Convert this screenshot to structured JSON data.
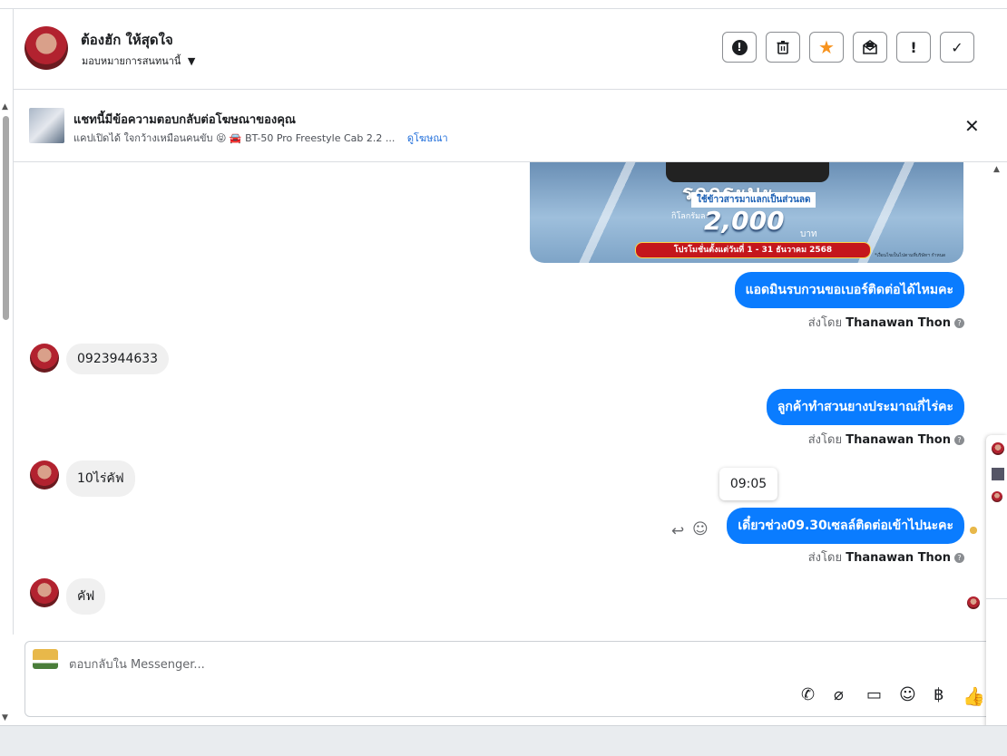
{
  "header": {
    "contact_name": "ต้องฮัก ให้สุดใจ",
    "assign_label": "มอบหมายการสนทนานี้",
    "buttons": [
      {
        "name": "report-button",
        "icon": "!"
      },
      {
        "name": "delete-button",
        "icon": "🗑"
      },
      {
        "name": "star-button",
        "icon": "★"
      },
      {
        "name": "mark-unread-button",
        "icon": "✉"
      },
      {
        "name": "spam-button",
        "icon": "!"
      },
      {
        "name": "done-button",
        "icon": "✓"
      }
    ]
  },
  "ad": {
    "title": "แชทนี้มีข้อความตอบกลับต่อโฆษณาของคุณ",
    "subtitle": "แคปเปิดได้ ใจกว้างเหมือนคนขับ 😝 🚘 BT-50 Pro Freestyle Cab 2.2 ...",
    "link": "ดูโฆษณา"
  },
  "ad_image": {
    "headline": "รถกระบะ",
    "tag": "ใช้ข้าวสารมาแลกเป็นส่วนลด",
    "per_kg": "กิโลกรัมละ",
    "amount": "2,000",
    "unit": "บาท",
    "promo": "โปรโมชั่นตั้งแต่วันที่ 1 - 31 ธันวาคม 2568",
    "note": "*เงื่อนไขเป็นไปตามที่บริษัทฯ กำหนด"
  },
  "messages": {
    "m1": "แอดมินรบกวนขอเบอร์ติดต่อได้ไหมคะ",
    "m2": "0923944633",
    "m3": "ลูกค้าทำสวนยางประมาณกี่ไร่คะ",
    "m4": "10ไร่คัฟ",
    "m5": "เดี๋ยวช่วง09.30เซลล์ติดต่อเข้าไปนะคะ",
    "m6": "คัฟ"
  },
  "sent_by_prefix": "ส่งโดย",
  "sent_by_name": "Thanawan Thon",
  "tooltip_time": "09:05",
  "composer": {
    "placeholder": "ตอบกลับใน Messenger..."
  },
  "colors": {
    "accent": "#0a7cff",
    "star": "#f7931e"
  }
}
